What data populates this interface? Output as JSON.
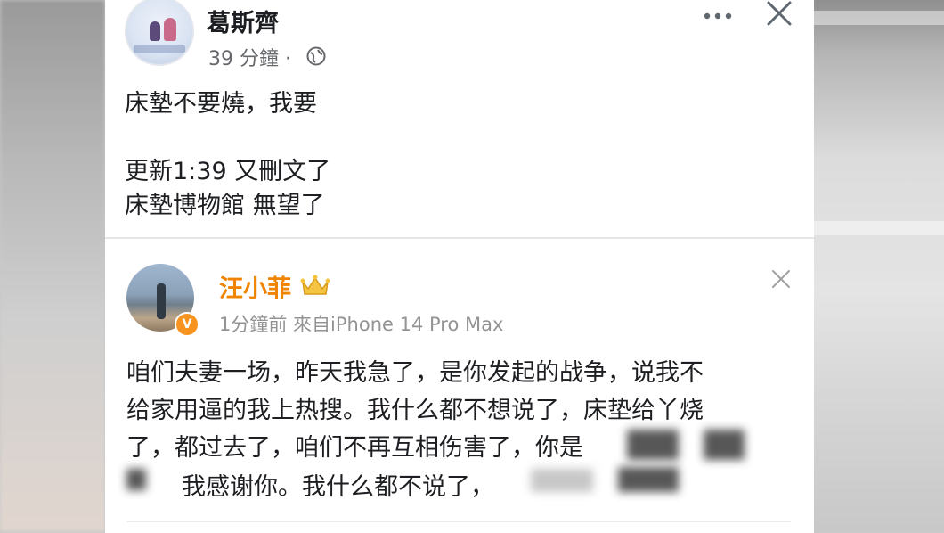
{
  "facebook_post": {
    "author": "葛斯齊",
    "time": "39 分鐘 ·",
    "icons": {
      "visibility": "globe-icon",
      "more": "more-icon",
      "close": "close-icon"
    },
    "lines": [
      "床墊不要燒，我要",
      "",
      "更新1:39 又刪文了",
      "床墊博物館 無望了"
    ]
  },
  "weibo_post": {
    "author": "汪小菲",
    "badge": "V",
    "time_source": "1分鐘前  來自iPhone 14 Pro Max",
    "lines": [
      "咱们夫妻一场，昨天我急了，是你发起的战争，说我不",
      "给家用逼的我上热搜。我什么都不想说了，床垫给丫烧",
      "了，都过去了，咱们不再互相伤害了，你是",
      "我感谢你。我什么都不说了，"
    ],
    "name_color": "#f08300"
  }
}
